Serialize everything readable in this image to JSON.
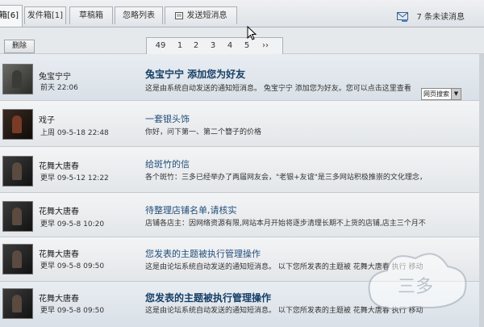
{
  "tabs": [
    {
      "label": "箱[6]",
      "active": true
    },
    {
      "label": "发件箱[1]",
      "active": false
    },
    {
      "label": "草稿箱",
      "active": false
    },
    {
      "label": "忽略列表",
      "active": false
    },
    {
      "label": "发送短消息",
      "active": false,
      "icon": "compose-icon"
    }
  ],
  "unread": {
    "count": "7",
    "label": "条未读消息",
    "icon": "message-icon"
  },
  "toolbar": {
    "delete_label": "删除"
  },
  "pager": {
    "pages": [
      "49",
      "1",
      "2",
      "3",
      "4",
      "5",
      "››"
    ]
  },
  "websearch": {
    "label": "网页搜索"
  },
  "messages": [
    {
      "sender": "兔宝宁宁",
      "time": "前天 22:06",
      "subject": "兔宝宁宁 添加您为好友",
      "subject_bold": true,
      "preview": "这是由系统自动发送的通知短消息。 兔宝宁宁 添加您为好友。您可以点击这里查看",
      "unread": true
    },
    {
      "sender": "戏子",
      "time": "上周 09-5-18 22:48",
      "subject": "一套银头饰",
      "subject_bold": false,
      "preview": "你好，问下第一、第二个簪子的价格",
      "unread": false
    },
    {
      "sender": "花舞大唐春",
      "time": "更早 09-5-12 12:22",
      "subject": "给斑竹的信",
      "subject_bold": false,
      "preview": "各个斑竹：三多已经举办了两届网友会，\"老银+友谊\"是三多网站积极推崇的文化理念，",
      "unread": false
    },
    {
      "sender": "花舞大唐春",
      "time": "更早 09-5-8 10:20",
      "subject": "待整理店铺名单,请核实",
      "subject_bold": false,
      "preview": "店铺各店主：因网络资源有限,网站本月开始将逐步清理长期不上货的店铺,店主三个月不",
      "unread": false
    },
    {
      "sender": "花舞大唐春",
      "time": "更早 09-5-8 09:50",
      "subject": "您发表的主题被执行管理操作",
      "subject_bold": false,
      "preview": "这是由论坛系统自动发送的通知短消息。 以下您所发表的主题被 花舞大唐春 执行 移动",
      "unread": false
    },
    {
      "sender": "花舞大唐春",
      "time": "更早 09-5-8 09:50",
      "subject": "您发表的主题被执行管理操作",
      "subject_bold": true,
      "preview": "这是由论坛系统自动发送的通知短消息。 以下您所发表的主题被 花舞大唐春 执行 移动",
      "unread": true
    }
  ],
  "watermark": {
    "text": "三多"
  }
}
